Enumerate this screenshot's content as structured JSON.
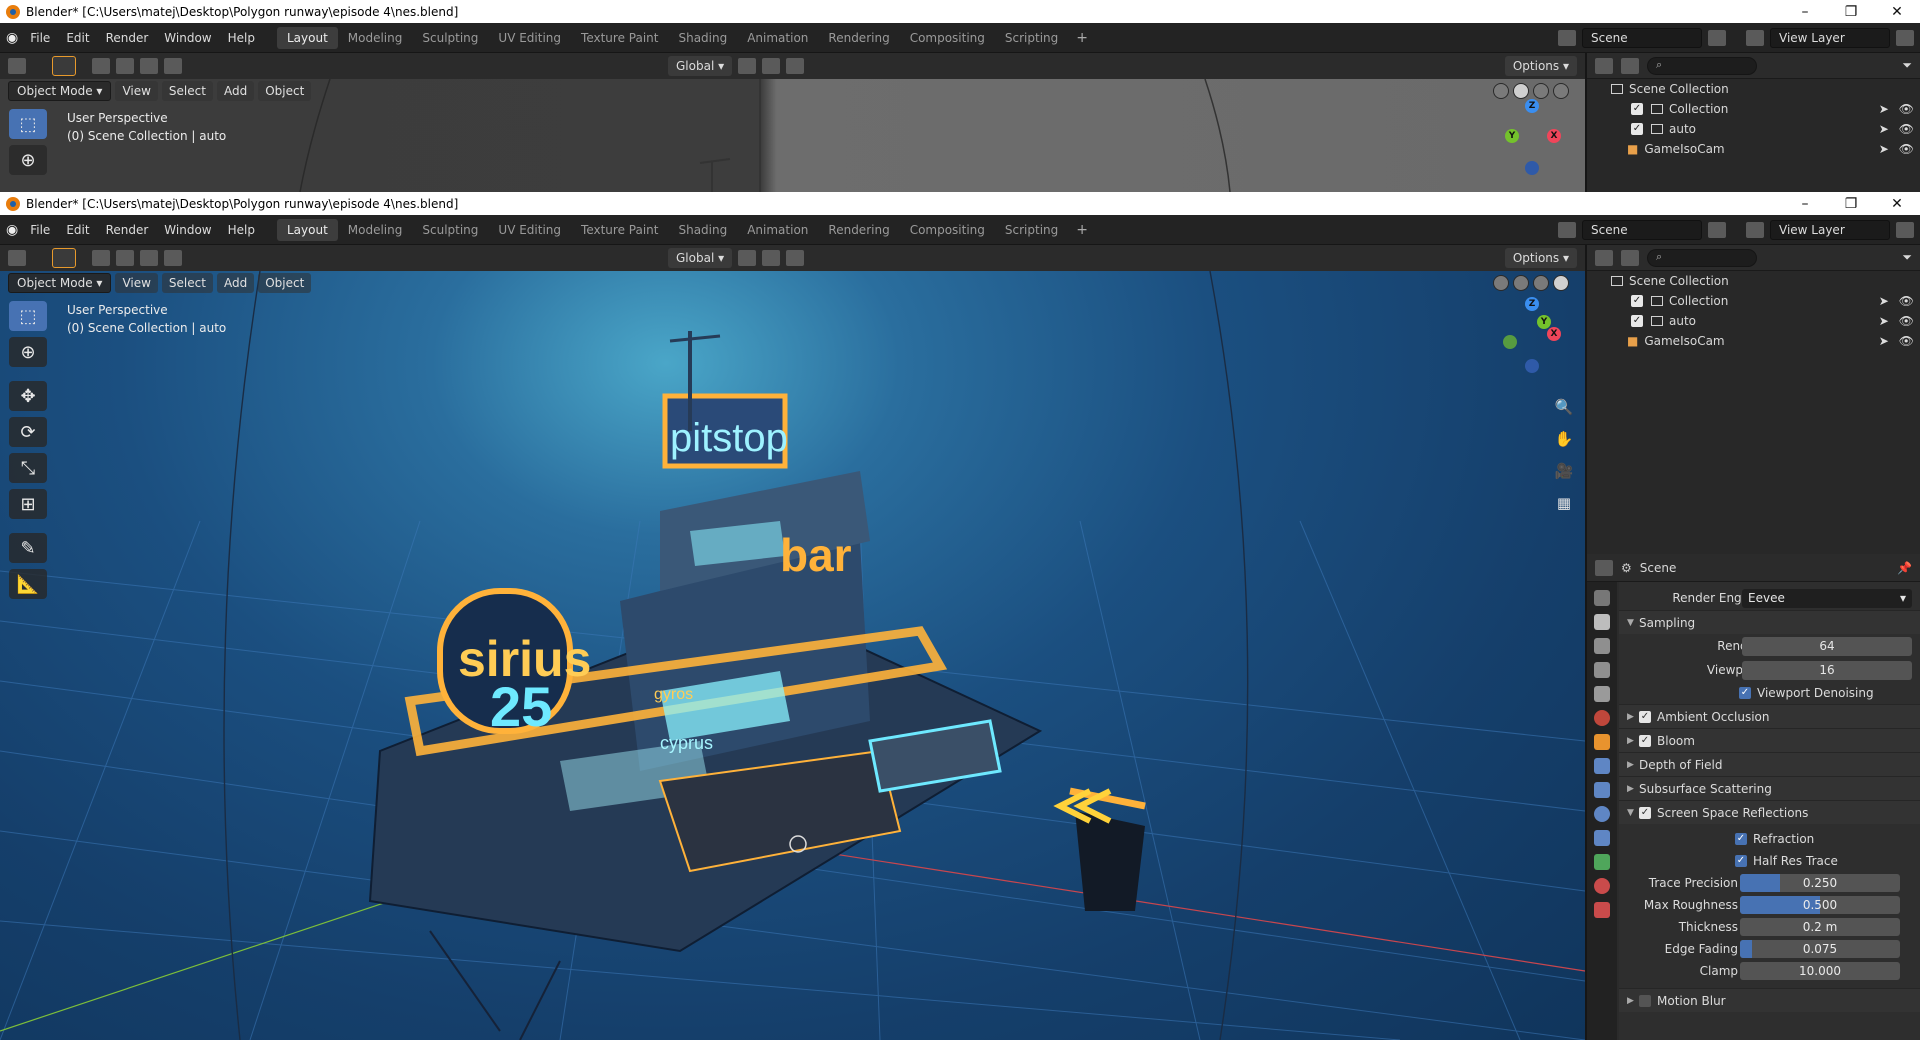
{
  "title": "Blender* [C:\\Users\\matej\\Desktop\\Polygon runway\\episode 4\\nes.blend]",
  "menu": [
    "File",
    "Edit",
    "Render",
    "Window",
    "Help"
  ],
  "workspaces": [
    "Layout",
    "Modeling",
    "Sculpting",
    "UV Editing",
    "Texture Paint",
    "Shading",
    "Animation",
    "Rendering",
    "Compositing",
    "Scripting"
  ],
  "active_workspace": "Layout",
  "scene": "Scene",
  "view_layer": "View Layer",
  "transform": {
    "orientation": "Global",
    "options": "Options"
  },
  "viewport_header": {
    "mode": "Object Mode",
    "menus": [
      "View",
      "Select",
      "Add",
      "Object"
    ]
  },
  "viewport_info": {
    "line1": "User Perspective",
    "line2": "(0) Scene Collection | auto"
  },
  "outliner": {
    "root": "Scene Collection",
    "items": [
      {
        "label": "Collection"
      },
      {
        "label": "auto"
      },
      {
        "label": "GameIsoCam"
      }
    ]
  },
  "scene_signs": {
    "pitstop": "pitstop",
    "bar": "bar",
    "sirius": "sirius",
    "number": "25",
    "gyros": "gyros",
    "cyprus": "cyprus"
  },
  "properties": {
    "context": "Scene",
    "render_engine_label": "Render Engine",
    "render_engine": "Eevee",
    "sampling": {
      "title": "Sampling",
      "render_label": "Render",
      "render": "64",
      "viewport_label": "Viewport",
      "viewport": "16",
      "denoise_label": "Viewport Denoising"
    },
    "panels": [
      {
        "label": "Ambient Occlusion",
        "checkbox": true
      },
      {
        "label": "Bloom",
        "checkbox": true
      },
      {
        "label": "Depth of Field",
        "checkbox": false
      },
      {
        "label": "Subsurface Scattering",
        "checkbox": false
      }
    ],
    "ssr": {
      "title": "Screen Space Reflections",
      "refraction": "Refraction",
      "half_res": "Half Res Trace",
      "fields": [
        {
          "label": "Trace Precision",
          "value": "0.250",
          "fill": 0.25
        },
        {
          "label": "Max Roughness",
          "value": "0.500",
          "fill": 0.5
        },
        {
          "label": "Thickness",
          "value": "0.2 m",
          "fill": 0
        },
        {
          "label": "Edge Fading",
          "value": "0.075",
          "fill": 0.075
        },
        {
          "label": "Clamp",
          "value": "10.000",
          "fill": 0
        }
      ]
    },
    "motion_blur": "Motion Blur"
  },
  "colors": {
    "accent": "#4772b3",
    "neon_orange": "#ffb23a",
    "neon_cyan": "#6ee9ff"
  }
}
